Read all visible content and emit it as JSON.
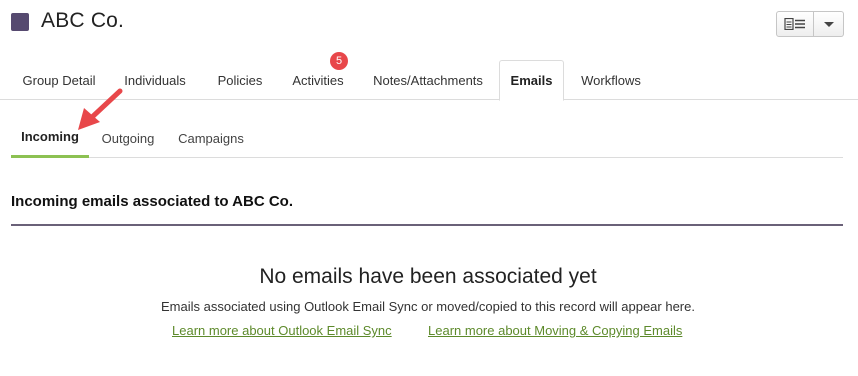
{
  "header": {
    "title": "ABC Co.",
    "brand_color": "#564a70",
    "actions": {
      "menu_icon": "list-view-icon",
      "dropdown_icon": "chevron-down-icon"
    }
  },
  "tabs": [
    {
      "label": "Group Detail"
    },
    {
      "label": "Individuals"
    },
    {
      "label": "Policies"
    },
    {
      "label": "Activities",
      "badge": "5"
    },
    {
      "label": "Notes/Attachments"
    },
    {
      "label": "Emails",
      "active": true
    },
    {
      "label": "Workflows"
    }
  ],
  "subtabs": [
    {
      "label": "Incoming",
      "active": true
    },
    {
      "label": "Outgoing"
    },
    {
      "label": "Campaigns"
    }
  ],
  "section": {
    "heading": "Incoming emails associated to ABC Co."
  },
  "empty_state": {
    "title": "No emails have been associated yet",
    "text": "Emails associated using Outlook Email Sync or moved/copied to this record will appear here.",
    "links": [
      {
        "label": "Learn more about Outlook Email Sync"
      },
      {
        "label": "Learn more about Moving & Copying Emails"
      }
    ]
  },
  "colors": {
    "accent_green": "#8cc152",
    "link_green": "#5d8a2b",
    "badge_red": "#e8474a",
    "annotation_arrow": "#e8474a"
  }
}
